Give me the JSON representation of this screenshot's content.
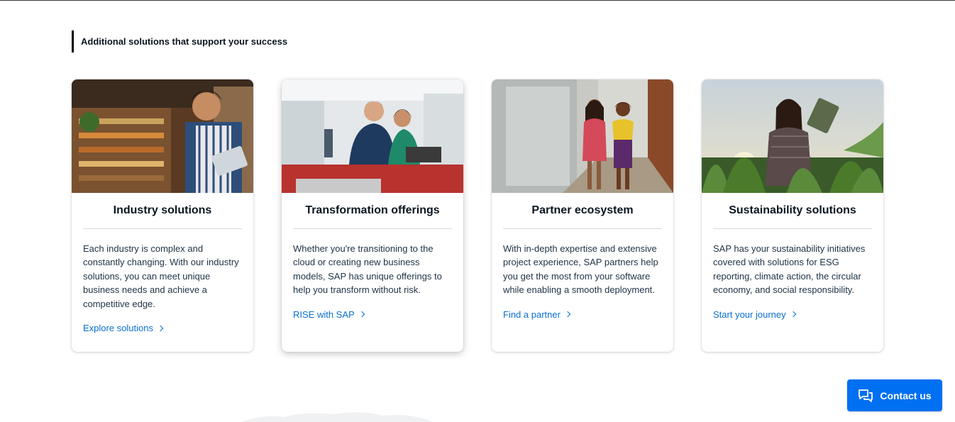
{
  "section": {
    "heading": "Additional solutions that support your success"
  },
  "cards": [
    {
      "title": "Industry solutions",
      "text": "Each industry is complex and constantly changing. With our industry solutions, you can meet unique business needs and achieve a competitive edge.",
      "link": "Explore solutions",
      "image": "woman-with-tablet-in-grocery-store"
    },
    {
      "title": "Transformation offerings",
      "text": "Whether you're transitioning to the cloud or creating new business models, SAP has unique offerings to help you transform without risk.",
      "link": "RISE with SAP",
      "image": "colleagues-at-workstation"
    },
    {
      "title": "Partner ecosystem",
      "text": "With in-depth expertise and extensive project experience, SAP partners help you get the most from your software while enabling a smooth deployment.",
      "link": "Find a partner",
      "image": "two-women-walking-in-office-corridor"
    },
    {
      "title": "Sustainability solutions",
      "text": "SAP has your sustainability initiatives covered with solutions for ESG reporting, climate action, the circular economy, and social responsibility.",
      "link": "Start your journey",
      "image": "farmer-with-tablet-in-corn-field"
    }
  ],
  "contact": {
    "label": "Contact us",
    "icon": "chat-bubbles-icon"
  },
  "colors": {
    "link": "#0a6ed1",
    "contact_button": "#0070f2",
    "heading_bar": "#000000"
  }
}
